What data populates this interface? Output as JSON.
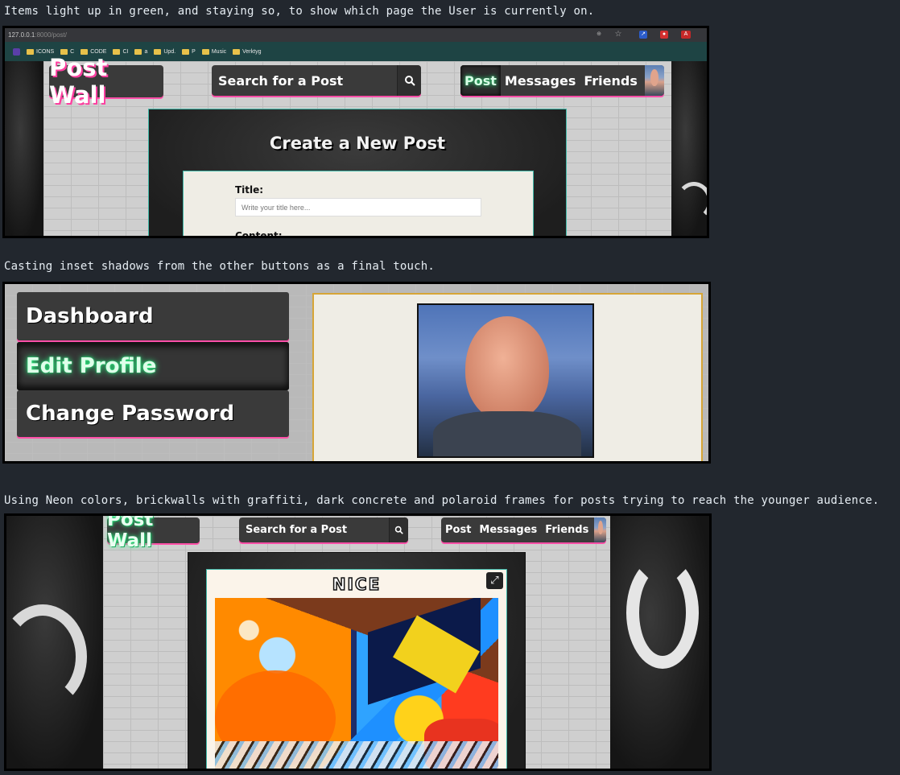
{
  "captions": {
    "c1": "Items light up in green, and staying so, to show which page the User is currently on.",
    "c2": "Casting inset shadows from the other buttons as a final touch.",
    "c3": "Using Neon colors, brickwalls with graffiti, dark concrete and polaroid frames for posts trying to reach the younger audience."
  },
  "colors": {
    "neon_green": "#2bff88",
    "neon_pink": "#ff4fa8",
    "teal": "#3fb8a8",
    "gold": "#d6a537",
    "page_bg": "#22272e"
  },
  "browser": {
    "url_host": "127.0.0.1",
    "url_rest": ":8000/post/",
    "bookmarks": [
      "ICONS",
      "C",
      "CODE",
      "CI",
      "a",
      "Upd.",
      "P",
      "Music",
      "Verktyg"
    ]
  },
  "site": {
    "logo": "Post Wall",
    "search_placeholder": "Search for a Post",
    "nav": [
      "Post",
      "Messages",
      "Friends"
    ]
  },
  "create_post": {
    "heading": "Create a New Post",
    "title_label": "Title:",
    "title_placeholder": "Write your title here...",
    "content_label": "Content:"
  },
  "dashboard_menu": [
    "Dashboard",
    "Edit Profile",
    "Change Password"
  ],
  "post": {
    "title": "NICE"
  },
  "icons": [
    "search-icon",
    "zoom-icon",
    "star-icon",
    "expand-icon",
    "folder-icon"
  ]
}
